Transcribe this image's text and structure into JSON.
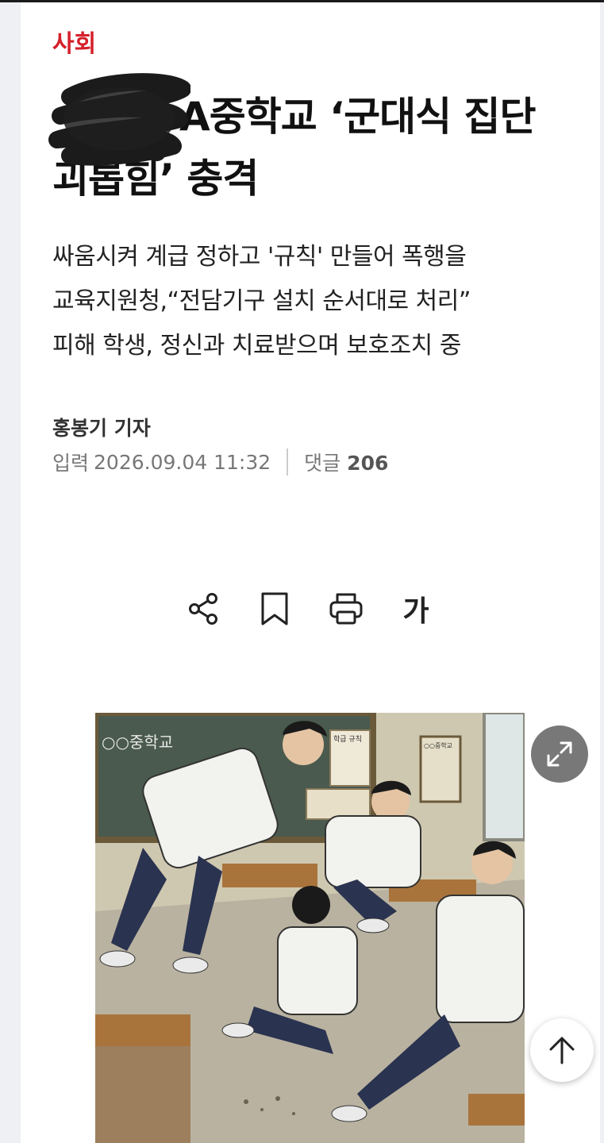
{
  "article": {
    "section": "사회",
    "headline": "A중학교 ‘군대식 집단 괴롭힘’ 충격",
    "subtitle_lines": [
      "싸움시켜 계급 정하고 '규칙' 만들어 폭행을",
      "교육지원청,“전담기구 설치 순서대로 처리”",
      "피해 학생, 정신과 치료받으며 보호조치 중"
    ],
    "reporter": "홍봉기 기자",
    "date_label": "입력",
    "date": "2026.09.04 11:32",
    "comments_label": "댓글",
    "comments_count": "206"
  },
  "toolbar": {
    "share_icon": "share-icon",
    "bookmark_icon": "bookmark-icon",
    "print_icon": "print-icon",
    "font_size_label": "가"
  },
  "image": {
    "blackboard_text": "○○중학교",
    "board_notice_text": "학급 규칙",
    "side_board_text": "○○중학교"
  },
  "buttons": {
    "expand_icon": "expand-icon",
    "scroll_top_icon": "arrow-up-icon"
  },
  "colors": {
    "section": "#d5202a",
    "headline": "#111111",
    "meta": "#777777"
  }
}
